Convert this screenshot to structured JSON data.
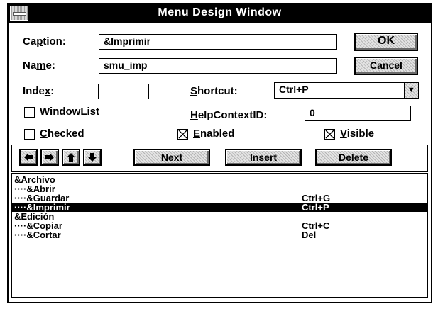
{
  "window": {
    "title": "Menu Design Window"
  },
  "form": {
    "caption_label": "Caption:",
    "caption_value": "&Imprimir",
    "name_label": "Name:",
    "name_value": "smu_imp",
    "index_label": "Index:",
    "index_value": "",
    "shortcut_label": "Shortcut:",
    "shortcut_value": "Ctrl+P",
    "helpcontext_label": "HelpContextID:",
    "helpcontext_value": "0",
    "windowlist_label": "WindowList",
    "windowlist_checked": false,
    "checked_label": "Checked",
    "checked_checked": false,
    "enabled_label": "Enabled",
    "enabled_checked": true,
    "visible_label": "Visible",
    "visible_checked": true
  },
  "buttons": {
    "ok": "OK",
    "cancel": "Cancel",
    "next": "Next",
    "insert": "Insert",
    "delete": "Delete"
  },
  "icons": {
    "left": "arrow-left-icon",
    "right": "arrow-right-icon",
    "up": "arrow-up-icon",
    "down": "arrow-down-icon",
    "combo": "combo-dropdown-icon"
  },
  "menu_items": [
    {
      "caption": "&Archivo",
      "shortcut": ""
    },
    {
      "caption": "····&Abrir",
      "shortcut": ""
    },
    {
      "caption": "····&Guardar",
      "shortcut": "Ctrl+G"
    },
    {
      "caption": "····&Imprimir",
      "shortcut": "Ctrl+P",
      "selected": true
    },
    {
      "caption": "&Edición",
      "shortcut": ""
    },
    {
      "caption": "····&Copiar",
      "shortcut": "Ctrl+C"
    },
    {
      "caption": "····&Cortar",
      "shortcut": "Del"
    }
  ],
  "colors": {
    "selection": "#000000",
    "titlebar": "#000000"
  }
}
